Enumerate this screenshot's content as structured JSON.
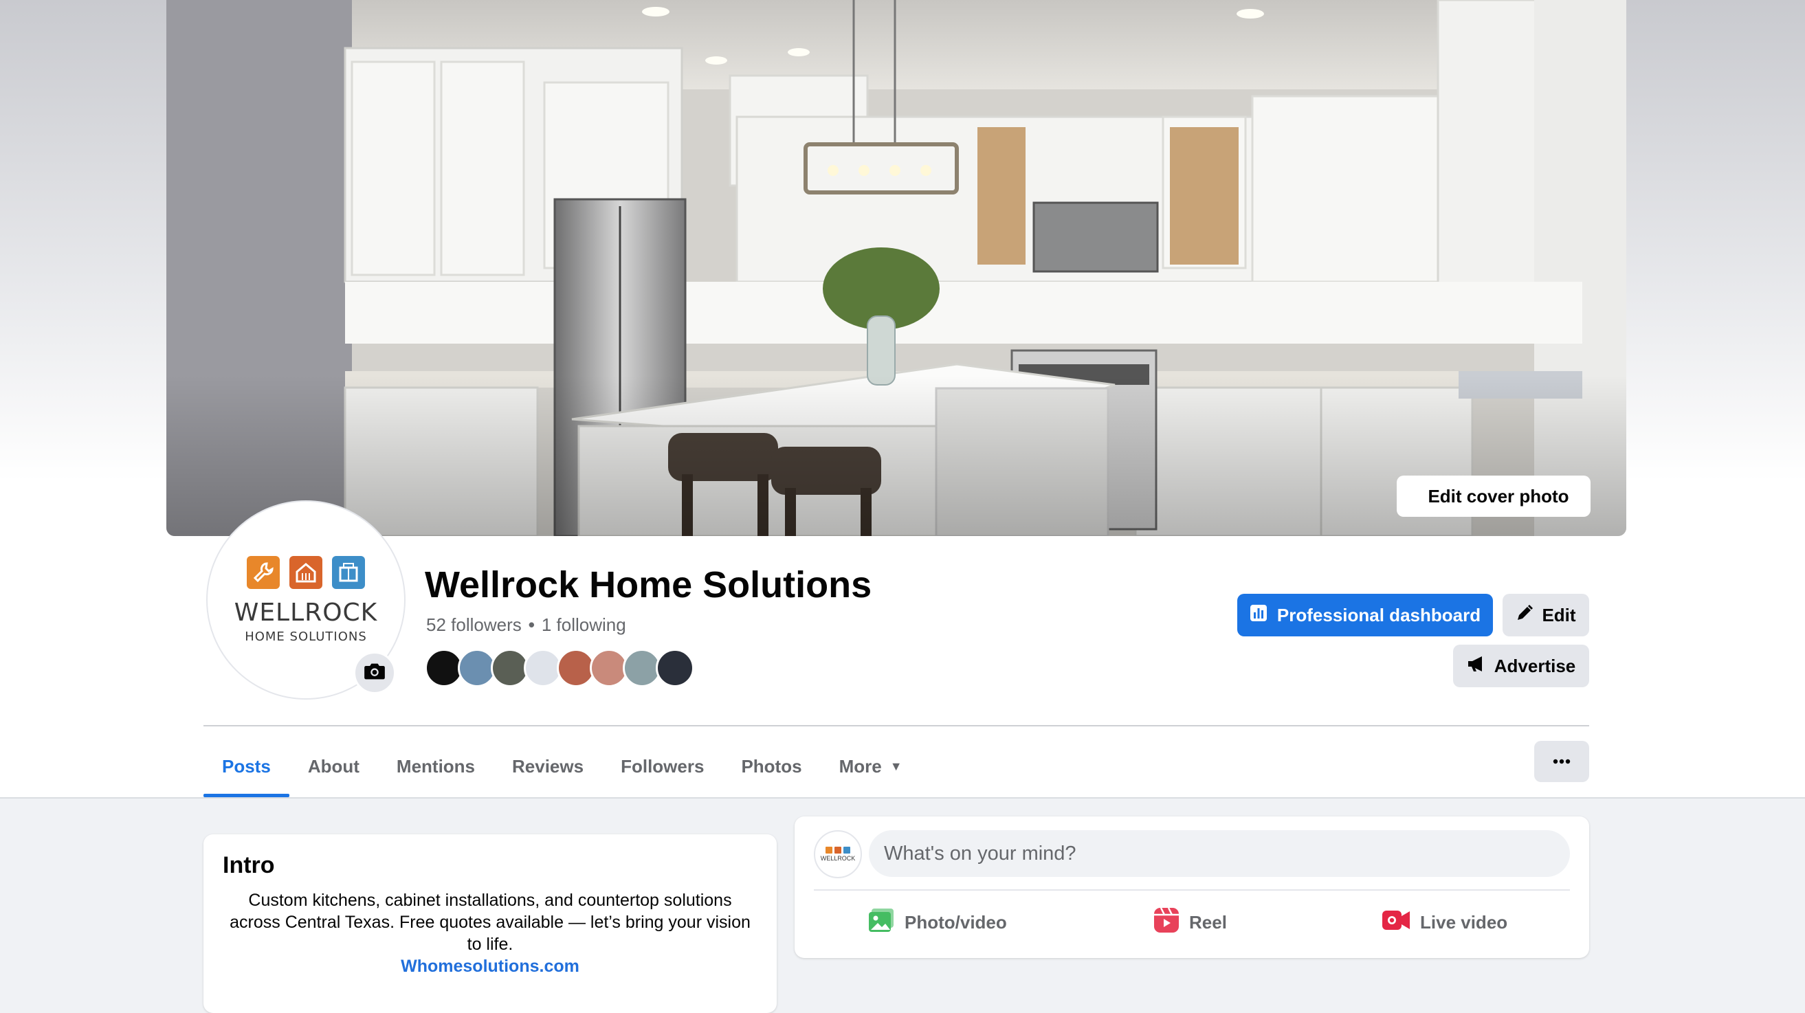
{
  "cover": {
    "edit_label": "Edit cover photo"
  },
  "profile": {
    "logo_word": "WELLROCK",
    "logo_sub": "HOME SOLUTIONS",
    "name": "Wellrock Home Solutions",
    "followers": "52 followers",
    "separator": "•",
    "following": "1 following"
  },
  "actions": {
    "dashboard_label": "Professional dashboard",
    "edit_label": "Edit",
    "advertise_label": "Advertise"
  },
  "tabs": [
    {
      "label": "Posts",
      "active": true
    },
    {
      "label": "About"
    },
    {
      "label": "Mentions"
    },
    {
      "label": "Reviews"
    },
    {
      "label": "Followers"
    },
    {
      "label": "Photos"
    },
    {
      "label": "More",
      "caret": "▼"
    }
  ],
  "intro": {
    "title": "Intro",
    "bio": "Custom kitchens, cabinet installations, and countertop solutions across Central Texas. Free quotes available — let’s bring your vision to life.",
    "link": "Whomesolutions.com"
  },
  "composer": {
    "placeholder": "What's on your mind?",
    "photo_label": "Photo/video",
    "reel_label": "Reel",
    "live_label": "Live video"
  },
  "colors": {
    "accent": "#1b74e4",
    "logo_orange": "#e8872a",
    "logo_red_orange": "#d9652b",
    "logo_blue": "#3d8ec8",
    "photo_green": "#45bd62",
    "reel_pink": "#e8425a",
    "live_red": "#e42645"
  },
  "icons": {
    "camera": "camera-icon",
    "dashboard": "chart-icon",
    "edit": "pencil-icon",
    "advertise": "megaphone-icon",
    "more": "ellipsis-icon"
  }
}
